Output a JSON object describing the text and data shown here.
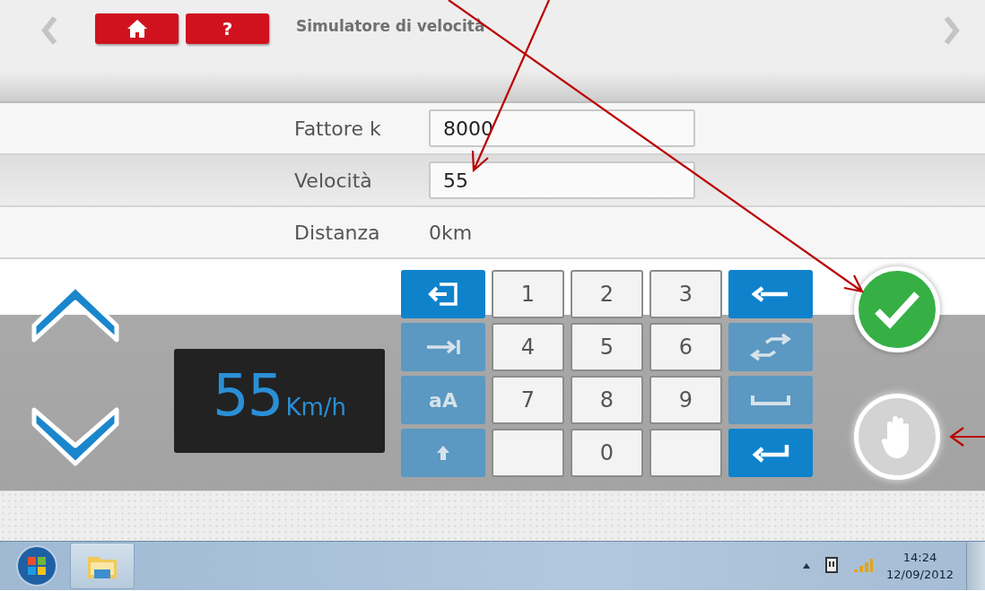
{
  "header": {
    "title": "Simulatore di velocità",
    "help_label": "?"
  },
  "fields": [
    {
      "label": "Fattore k",
      "kind": "input",
      "value": "8000",
      "selected": false
    },
    {
      "label": "Velocità",
      "kind": "input",
      "value": "55",
      "selected": true
    },
    {
      "label": "Distanza",
      "kind": "readout",
      "value": "0km",
      "selected": false
    }
  ],
  "display": {
    "value": "55",
    "unit": "Km/h"
  },
  "keypad": {
    "left_keys": [
      {
        "kind": "exit",
        "disabled": false
      },
      {
        "kind": "tab",
        "disabled": true
      },
      {
        "kind": "case",
        "label": "aA",
        "disabled": true
      },
      {
        "kind": "shift",
        "disabled": true
      }
    ],
    "digits": [
      {
        "kind": "digit",
        "label": "1"
      },
      {
        "kind": "digit",
        "label": "2"
      },
      {
        "kind": "digit",
        "label": "3"
      },
      {
        "kind": "digit",
        "label": "4"
      },
      {
        "kind": "digit",
        "label": "5"
      },
      {
        "kind": "digit",
        "label": "6"
      },
      {
        "kind": "digit",
        "label": "7"
      },
      {
        "kind": "digit",
        "label": "8"
      },
      {
        "kind": "digit",
        "label": "9"
      },
      {
        "kind": "blank"
      },
      {
        "kind": "digit",
        "label": "0"
      },
      {
        "kind": "blank"
      }
    ],
    "right_keys": [
      {
        "kind": "backspace",
        "disabled": false
      },
      {
        "kind": "swap",
        "disabled": true
      },
      {
        "kind": "space",
        "disabled": true
      },
      {
        "kind": "enter",
        "disabled": false
      }
    ]
  },
  "actions": [
    {
      "kind": "confirm",
      "disabled": false
    },
    {
      "kind": "stop",
      "disabled": true
    }
  ],
  "taskbar": {
    "time": "14:24",
    "date": "12/09/2012"
  }
}
